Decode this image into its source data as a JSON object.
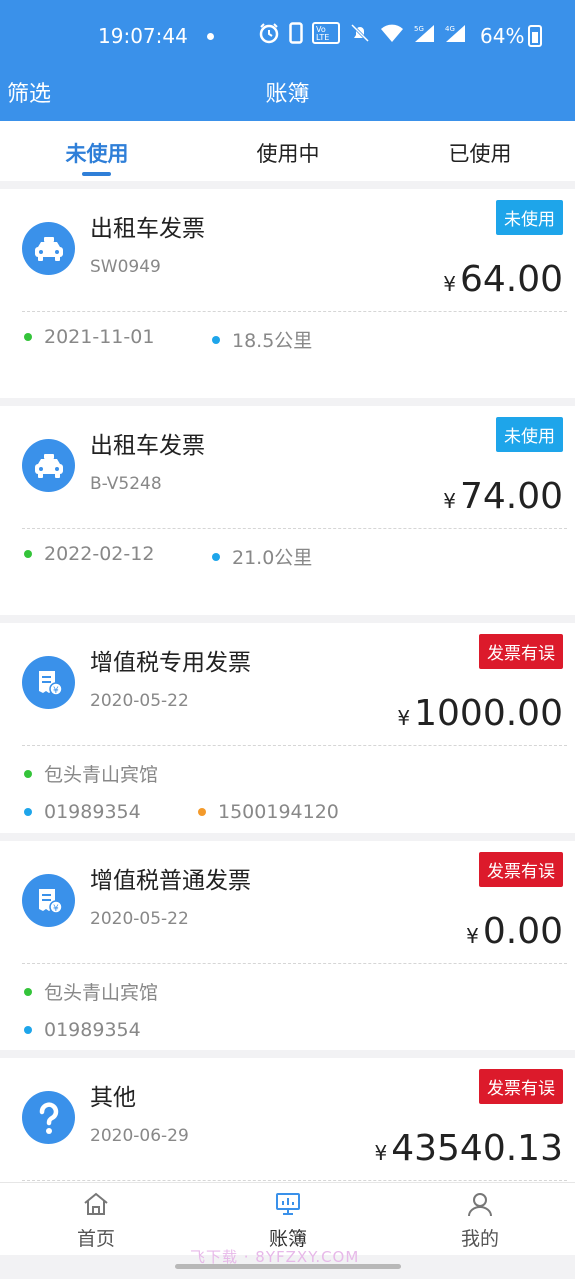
{
  "status_bar": {
    "time": "19:07:44",
    "battery": "64%",
    "icons": [
      "alarm-icon",
      "phone-icon",
      "volte-icon",
      "mute-icon",
      "wifi-icon",
      "signal-5g-icon",
      "signal-4g-icon"
    ]
  },
  "header": {
    "filter_label": "筛选",
    "title": "账簿"
  },
  "tabs": [
    {
      "label": "未使用",
      "active": true
    },
    {
      "label": "使用中",
      "active": false
    },
    {
      "label": "已使用",
      "active": false
    }
  ],
  "invoices": [
    {
      "title": "出租车发票",
      "sub": "SW0949",
      "status": "未使用",
      "currency": "¥",
      "amount": "64.00",
      "meta": [
        {
          "text": "2021-11-01"
        },
        {
          "text": "18.5公里"
        }
      ]
    },
    {
      "title": "出租车发票",
      "sub": "B-V5248",
      "status": "未使用",
      "currency": "¥",
      "amount": "74.00",
      "meta": [
        {
          "text": "2022-02-12"
        },
        {
          "text": "21.0公里"
        }
      ]
    },
    {
      "title": "增值税专用发票",
      "sub": "2020-05-22",
      "status": "发票有误",
      "currency": "¥",
      "amount": "1000.00",
      "meta": [
        {
          "text": "包头青山宾馆"
        },
        {
          "text": "01989354"
        },
        {
          "text": "1500194120"
        }
      ]
    },
    {
      "title": "增值税普通发票",
      "sub": "2020-05-22",
      "status": "发票有误",
      "currency": "¥",
      "amount": "0.00",
      "meta": [
        {
          "text": "包头青山宾馆"
        },
        {
          "text": "01989354"
        }
      ]
    },
    {
      "title": "其他",
      "sub": "2020-06-29",
      "status": "发票有误",
      "currency": "¥",
      "amount": "43540.13",
      "meta": []
    }
  ],
  "nav": [
    {
      "label": "首页",
      "icon": "home-icon"
    },
    {
      "label": "账簿",
      "icon": "ledger-icon"
    },
    {
      "label": "我的",
      "icon": "user-icon"
    }
  ],
  "watermark": "飞下载 · 8YFZXY.COM",
  "colors": {
    "primary": "#3a91ea",
    "tab_active": "#2f7fd8",
    "badge_unused": "#1ea5ea",
    "badge_error": "#dc1a2b"
  }
}
